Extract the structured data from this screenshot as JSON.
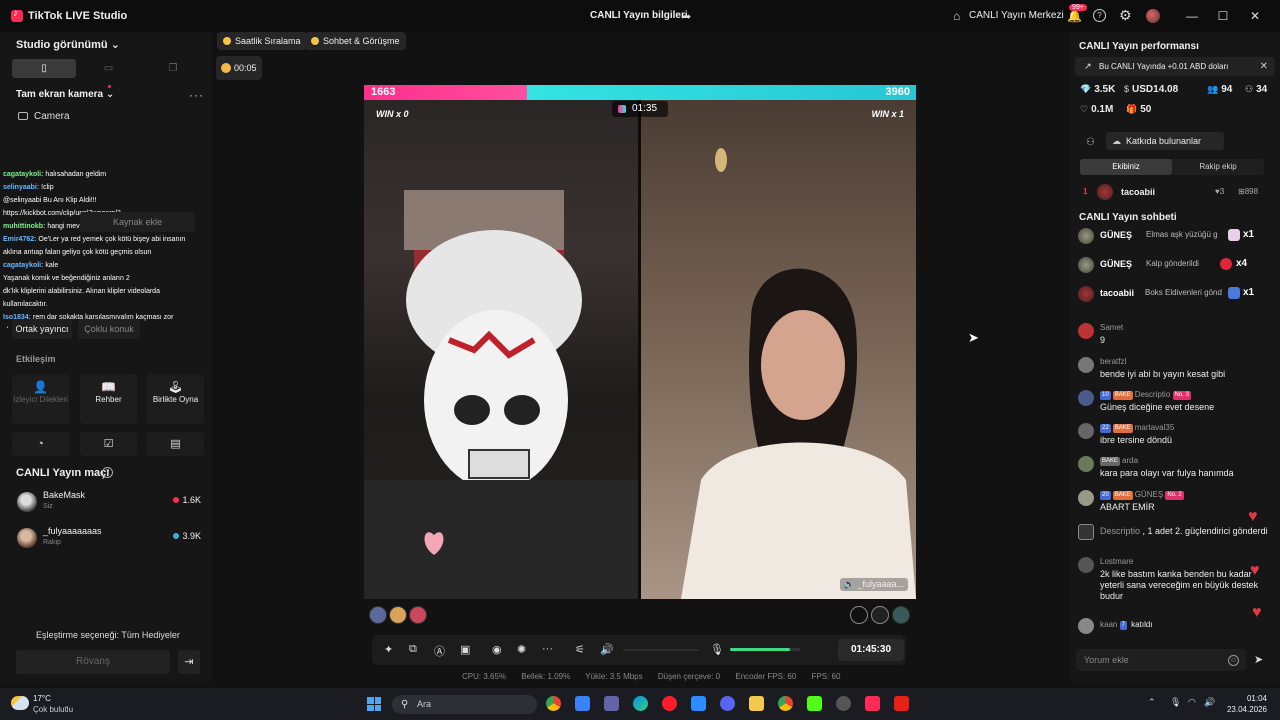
{
  "titlebar": {
    "app_title": "TikTok LIVE Studio",
    "live_info": "CANLI Yayın bilgileri",
    "center_link": "CANLI Yayın Merkezi",
    "notif_count": "99+"
  },
  "left": {
    "studio_view": "Studio görünümü",
    "camera_section": "Tam ekran kamera",
    "camera_item": "Camera",
    "overlay_chat": [
      {
        "user": "cagataykoli:",
        "text": "halısahadan geldim"
      },
      {
        "user": "selinyaabi:",
        "text": "!clip"
      },
      {
        "user": "",
        "text": "@selinyaabi Bu Anı Klip Aldi!!!"
      },
      {
        "user": "",
        "text": "https://kickbot.com/clip/unpl7woqornl3"
      },
      {
        "user": "muhittinokb:",
        "text": "hangi mevki"
      },
      {
        "user": "Emir4762:",
        "text": "Oe'Ler ya red yemek çok kötü bişey abi insanın"
      },
      {
        "user": "",
        "text": "aklına antıap falan geliyo çok kötü geçmis olsun"
      },
      {
        "user": "cagataykoli:",
        "text": "kale"
      },
      {
        "user": "",
        "text": "Yaşanak komik ve beğendiğiniz anların 2"
      },
      {
        "user": "",
        "text": "dk'lık kliplerini alabilirsiniz. Alınan klipler videolarda"
      },
      {
        "user": "",
        "text": "kullanılacaktır."
      },
      {
        "user": "Iso1834:",
        "text": "rem dar sokakta karşılaşmıyalım kaçması zor"
      },
      {
        "user": "",
        "text": "oluyor"
      }
    ],
    "ghost_buttons": {
      "add_source": "Kaynak ekle",
      "co_host": "Ortak yayıncı",
      "multi_guest": "Çoklu konuk"
    },
    "interaction": "Etkileşim",
    "tiles": [
      {
        "label": "İzleyici Dilekleri",
        "icon": "user-icon"
      },
      {
        "label": "Rehber",
        "icon": "book-icon"
      },
      {
        "label": "Birlikte Oyna",
        "icon": "joystick-icon"
      }
    ],
    "match_title": "CANLI Yayın maçı",
    "players": [
      {
        "name": "BakeMask",
        "role": "Siz",
        "score": "1.6K"
      },
      {
        "name": "_fulyaaaaaaas",
        "role": "Rakip",
        "score": "3.9K"
      }
    ],
    "pairing": "Eşleştirme seçeneği: Tüm Hediyeler",
    "rematch": "Rövanş"
  },
  "center": {
    "pills": [
      "Saatlik Sıralama",
      "Sohbet & Görüşme"
    ],
    "live_timer": "00:05",
    "score_left": "1663",
    "score_right": "3960",
    "score_left_share": 0.2957,
    "win_left": "WIN x 0",
    "win_right": "WIN x 1",
    "battle_timer": "01:35",
    "guest_name": "_fulyaaaa...",
    "stream_clock": "01:45:30",
    "mic_level": 0.85,
    "stats": {
      "cpu": "CPU: 3.65%",
      "memory": "Bellek: 1.09%",
      "upload": "Yükle: 3.5 Mbps",
      "dropped": "Düşen çerçeve: 0",
      "encoder_fps": "Encoder FPS: 60",
      "fps": "FPS: 60"
    }
  },
  "right": {
    "title": "CANLI Yayın performansı",
    "promo": "Bu CANLI Yayında +0.01 ABD doları",
    "stats": {
      "diamonds": "3.5K",
      "usd": "USD14.08",
      "viewers": "94",
      "followers": "34",
      "likes": "0.1M",
      "gifters": "50"
    },
    "contributors_btn": "Katkıda bulunanlar",
    "team_tabs": [
      "Ekibiniz",
      "Rakip ekip"
    ],
    "top_contributor": {
      "rank": "1",
      "name": "tacoabii",
      "likes": "♥3",
      "gifts": "⊞898"
    },
    "chat_title": "CANLI Yayın sohbeti",
    "gifts": [
      {
        "name": "GÜNEŞ",
        "text": "Elmas aşk yüzüğü g",
        "count": "x1"
      },
      {
        "name": "GÜNEŞ",
        "text": "Kalp gönderildi",
        "count": "x4"
      },
      {
        "name": "tacoabii",
        "text": "Boks Eldivenleri gönd",
        "count": "x1"
      }
    ],
    "comments": [
      {
        "user": "Samet",
        "text": "9"
      },
      {
        "user": "beratfzl",
        "text": "bende iyi abi bı yayın kesat gibi"
      },
      {
        "user": "Descriptio",
        "b1": "10",
        "b2": "BAKE",
        "b3": "No. 3",
        "text": "Güneş diceğine evet desene"
      },
      {
        "user": "martaval35",
        "b1": "22",
        "b2": "BAKE",
        "text": "ibre tersine döndü"
      },
      {
        "user": "arda",
        "b2": "BAKE",
        "text": "kara para olayı var fulya hanımda"
      },
      {
        "user": "GÜNEŞ",
        "b1": "20",
        "b2": "BAKE",
        "b3": "No. 2",
        "text": "ABART EMİR"
      },
      {
        "user": "Descriptio",
        "text": "1 adet 2. güçlendirici gönderdi"
      },
      {
        "user": "Lostmare",
        "text": "2k like bastım kanka benden bu kadar yeterli sana vereceğim en büyük destek budur"
      },
      {
        "user": "kaan",
        "b1": "7",
        "text": "katıldı"
      }
    ],
    "comment_placeholder": "Yorum ekle"
  },
  "taskbar": {
    "temp": "17°C",
    "weather": "Çok bulutlu",
    "search": "Ara",
    "time": "01:04",
    "date": "23.04.2026"
  },
  "colors": {
    "accent": "#fe2c55",
    "team_pink": "#ff2e8a",
    "team_cyan": "#34e3e3",
    "mic_green": "#3ddc84"
  }
}
